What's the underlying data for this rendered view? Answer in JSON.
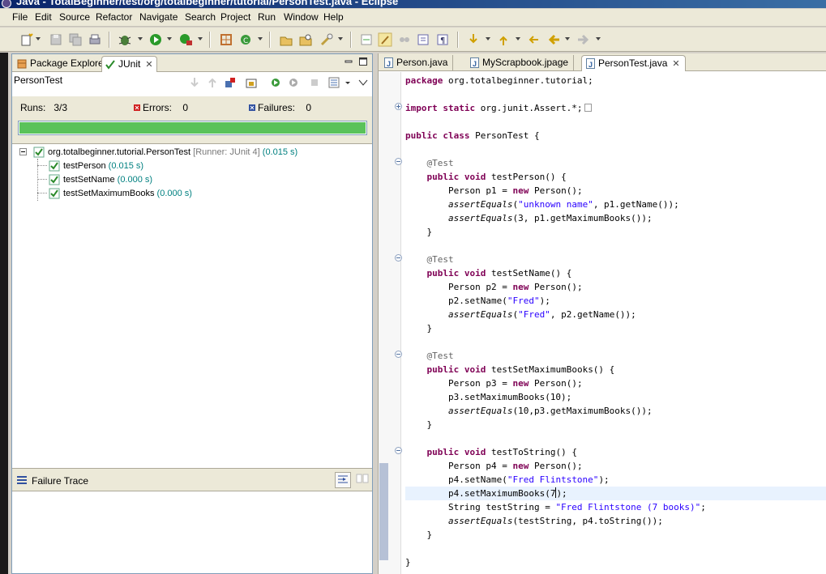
{
  "window": {
    "title": "Java - TotalBeginner/test/org/totalbeginner/tutorial/PersonTest.java - Eclipse"
  },
  "menu": [
    "File",
    "Edit",
    "Source",
    "Refactor",
    "Navigate",
    "Search",
    "Project",
    "Run",
    "Window",
    "Help"
  ],
  "left_view": {
    "tabs": [
      {
        "label": "Package Explorer",
        "icon": "package-explorer-icon"
      },
      {
        "label": "JUnit",
        "icon": "junit-icon"
      }
    ],
    "junit_title": "PersonTest",
    "runs_label": "Runs:",
    "runs_value": "3/3",
    "errors_label": "Errors:",
    "errors_value": "0",
    "failures_label": "Failures:",
    "failures_value": "0",
    "progress_fraction": 1.0,
    "progress_color": "#5ac25a",
    "tree": {
      "root": {
        "name": "org.totalbeginner.tutorial.PersonTest",
        "runner": "[Runner: JUnit 4]",
        "time": "(0.015 s)"
      },
      "children": [
        {
          "name": "testPerson",
          "time": "(0.015 s)"
        },
        {
          "name": "testSetName",
          "time": "(0.000 s)"
        },
        {
          "name": "testSetMaximumBooks",
          "time": "(0.000 s)"
        }
      ]
    },
    "failure_trace_label": "Failure Trace"
  },
  "editor": {
    "tabs": [
      {
        "label": "Person.java"
      },
      {
        "label": "MyScrapbook.jpage"
      },
      {
        "label": "PersonTest.java",
        "active": true
      }
    ],
    "code": {
      "package_kw": "package",
      "package_name": " org.totalbeginner.tutorial;",
      "import_kw": "import static",
      "import_name": " org.junit.Assert.*;",
      "class_kw": "public class",
      "class_name": " PersonTest {",
      "annotation": "@Test",
      "method_kw": "public void",
      "m1_sig": " testPerson() {",
      "m1_l1a": "Person p1 = ",
      "new_kw": "new",
      "m1_l1b": " Person();",
      "assert_fn": "assertEquals",
      "m1_l2a": "(",
      "m1_l2s": "\"unknown name\"",
      "m1_l2b": ", p1.getName());",
      "m1_l3": "(3, p1.getMaximumBooks());",
      "close_brace": "}",
      "m2_sig": " testSetName() {",
      "m2_l1a": "Person p2 = ",
      "m2_l2a": "p2.setName(",
      "m2_l2s": "\"Fred\"",
      "m2_l2b": ");",
      "m2_l3a": "(",
      "m2_l3b": ", p2.getName());",
      "m3_sig": " testSetMaximumBooks() {",
      "m3_l1a": "Person p3 = ",
      "m3_l2": "p3.setMaximumBooks(10);",
      "m3_l3": "(10,p3.getMaximumBooks());",
      "m4_sig": " testToString() {",
      "m4_l1a": "Person p4 = ",
      "m4_l2a": "p4.setName(",
      "m4_l2s": "\"Fred Flintstone\"",
      "m4_l2b": ");",
      "m4_l3a": "p4.setMaximumBooks(7",
      "m4_l3b": ");",
      "m4_l4a": "String testString = ",
      "m4_l4s": "\"Fred Flintstone (7 books)\"",
      "m4_l4b": ";",
      "m4_l5": "(testString, p4.toString());"
    }
  }
}
